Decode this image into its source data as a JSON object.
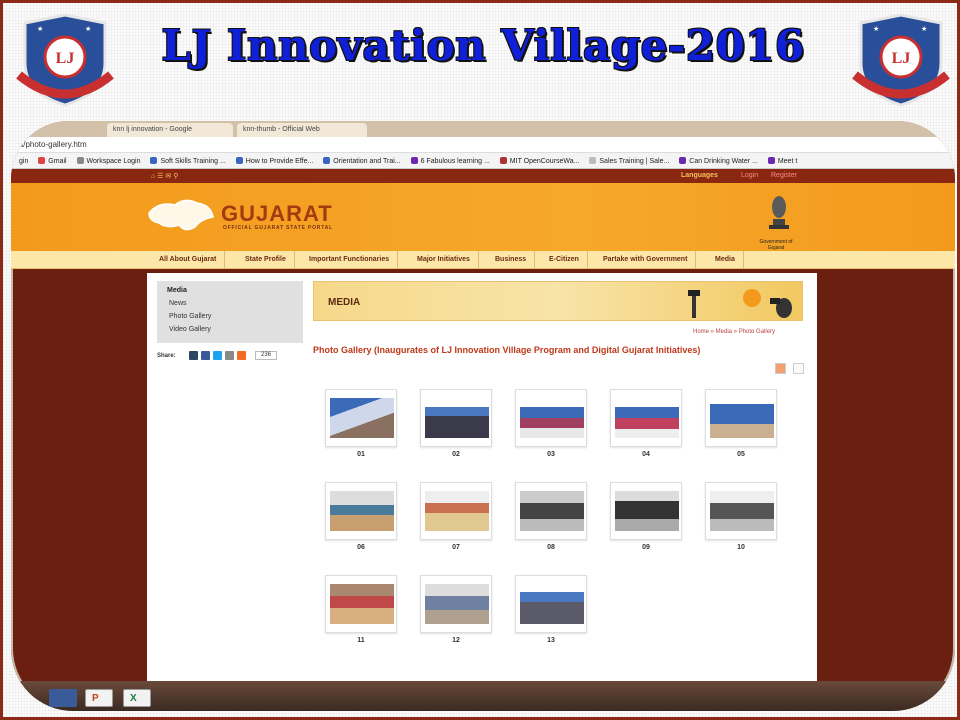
{
  "slide": {
    "title": "LJ Innovation Village-2016",
    "logo_text": "LOK JAGRUTI KENDRA"
  },
  "browser": {
    "tabs": [
      "knn lj innovation - Google",
      "knn-thumb - Official Web"
    ],
    "url": "ia/photo-gallery.htm",
    "bookmarks": [
      "gin",
      "Gmail",
      "Workspace Login",
      "Soft Skills Training ...",
      "How to Provide Effe...",
      "Orientation and Trai...",
      "6 Fabulous learning ...",
      "MIT OpenCourseWa...",
      "Sales Training | Sale...",
      "Can Drinking Water ...",
      "Meet t"
    ]
  },
  "site": {
    "top_links": [
      "Languages",
      "Login",
      "Register"
    ],
    "brand": "GUJARAT",
    "brand_sub": "OFFICIAL GUJARAT STATE PORTAL",
    "emblem_label": "Government of Gujarat",
    "nav": [
      "All About Gujarat",
      "State Profile",
      "Important Functionaries",
      "Major Initiatives",
      "Business",
      "E-Citizen",
      "Partake with Government",
      "Media"
    ]
  },
  "sidebar": {
    "heading": "Media",
    "items": [
      "News",
      "Photo Gallery",
      "Video Gallery"
    ],
    "share_label": "Share:",
    "share_count": "236"
  },
  "main": {
    "banner_title": "MEDIA",
    "breadcrumb": "Home » Media » Photo Gallery",
    "heading": "Photo Gallery (Inaugurates of LJ Innovation Village Program and Digital Gujarat Initiatives)",
    "thumbnails": [
      "01",
      "02",
      "03",
      "04",
      "05",
      "06",
      "07",
      "08",
      "09",
      "10",
      "11",
      "12",
      "13"
    ]
  },
  "colors": {
    "accent": "#f39a1c",
    "title_blue": "#1020d8",
    "border": "#8b2a16",
    "heading_red": "#c0381a"
  }
}
